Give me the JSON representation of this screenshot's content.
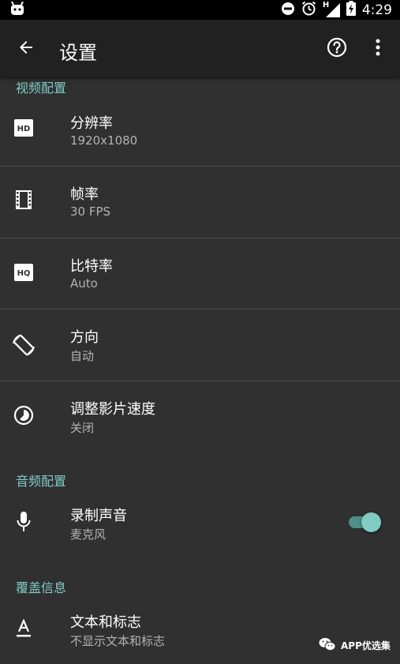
{
  "status_bar": {
    "time": "4:29",
    "network_label": "H"
  },
  "app_bar": {
    "title": "设置"
  },
  "sections": {
    "video": {
      "header": "视频配置",
      "items": [
        {
          "label": "分辨率",
          "value": "1920x1080",
          "icon": "hd-icon"
        },
        {
          "label": "帧率",
          "value": "30 FPS",
          "icon": "film-icon"
        },
        {
          "label": "比特率",
          "value": "Auto",
          "icon": "hq-icon"
        },
        {
          "label": "方向",
          "value": "自动",
          "icon": "screen-rotation-icon"
        },
        {
          "label": "调整影片速度",
          "value": "关闭",
          "icon": "timelapse-icon"
        }
      ]
    },
    "audio": {
      "header": "音频配置",
      "items": [
        {
          "label": "录制声音",
          "value": "麦克风",
          "icon": "mic-icon",
          "toggle_on": true
        }
      ]
    },
    "overlay": {
      "header": "覆盖信息",
      "items": [
        {
          "label": "文本和标志",
          "value": "不显示文本和标志",
          "icon": "text-format-icon"
        }
      ]
    }
  },
  "watermark": {
    "text": "APP优选集"
  },
  "colors": {
    "background": "#303030",
    "app_bar": "#212121",
    "accent": "#80cbc4",
    "secondary_text": "#b3b3b3",
    "divider": "#4a4a4a"
  }
}
